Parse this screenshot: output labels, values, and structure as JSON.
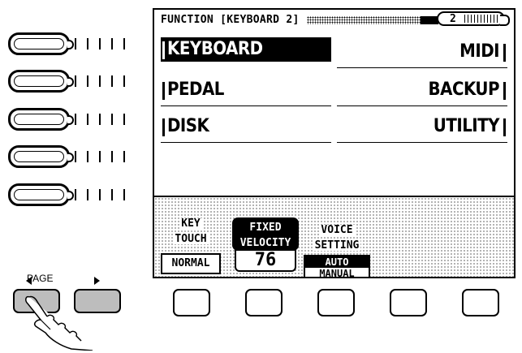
{
  "screen": {
    "title": "FUNCTION [KEYBOARD 2]",
    "page_number": "2"
  },
  "menu": {
    "left": [
      {
        "label": "KEYBOARD",
        "selected": true
      },
      {
        "label": "PEDAL",
        "selected": false
      },
      {
        "label": "DISK",
        "selected": false
      }
    ],
    "right": [
      {
        "label": "MIDI"
      },
      {
        "label": "BACKUP"
      },
      {
        "label": "UTILITY"
      }
    ]
  },
  "params": {
    "key_touch": {
      "label_line1": "KEY",
      "label_line2": "TOUCH",
      "value": "NORMAL"
    },
    "fixed_velocity": {
      "label_line1": "FIXED",
      "label_line2": "VELOCITY",
      "value": "76"
    },
    "voice_setting": {
      "label_line1": "VOICE",
      "label_line2": "SETTING",
      "option_selected": "AUTO",
      "option_other": "MANUAL"
    }
  },
  "controls": {
    "page_label": "PAGE"
  }
}
